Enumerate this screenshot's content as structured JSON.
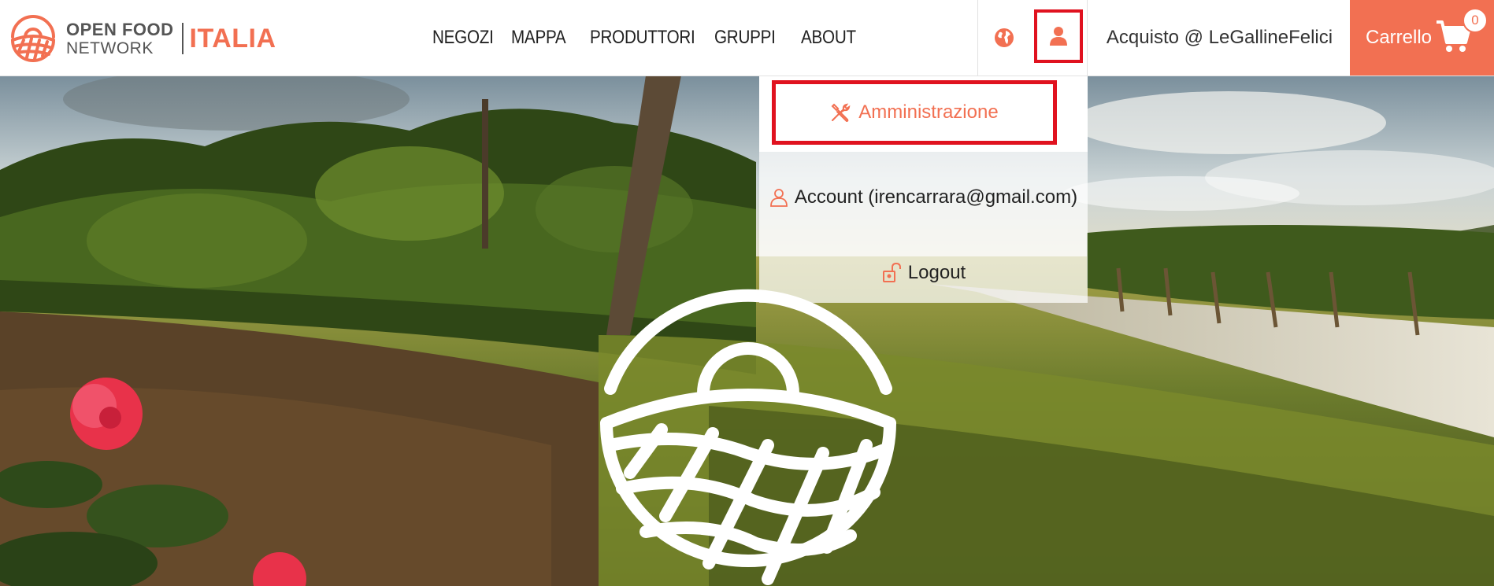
{
  "brand": {
    "line1": "OPEN FOOD",
    "line2": "NETWORK",
    "country": "ITALIA"
  },
  "nav": {
    "items": [
      {
        "label": "NEGOZI"
      },
      {
        "label": "MAPPA"
      },
      {
        "label": "PRODUTTORI"
      },
      {
        "label": "GRUPPI"
      },
      {
        "label": "ABOUT"
      }
    ]
  },
  "header": {
    "language_icon": "globe-icon",
    "user_icon": "user-icon",
    "user_label": "Acquisto @ LeGallineFelici"
  },
  "cart": {
    "label": "Carrello",
    "count": "0",
    "icon": "cart-icon"
  },
  "user_menu": {
    "admin_label": "Amministrazione",
    "account_label": "Account (irencarrara@gmail.com)",
    "logout_label": "Logout"
  },
  "colors": {
    "accent": "#f27052",
    "highlight": "#e0121f"
  }
}
